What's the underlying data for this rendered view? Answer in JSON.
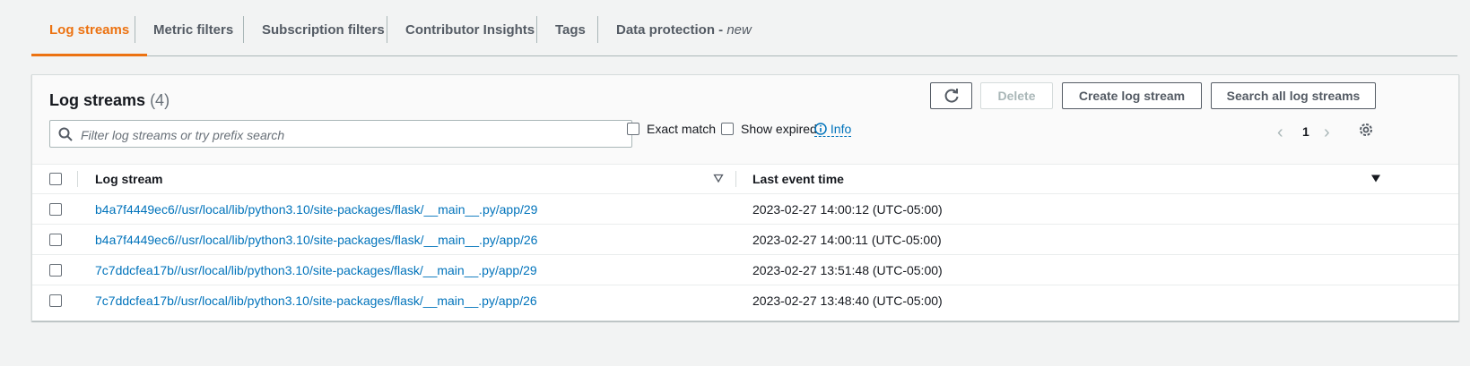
{
  "tabs": [
    {
      "label": "Log streams",
      "active": true
    },
    {
      "label": "Metric filters",
      "active": false
    },
    {
      "label": "Subscription filters",
      "active": false
    },
    {
      "label": "Contributor Insights",
      "active": false
    },
    {
      "label": "Tags",
      "active": false
    },
    {
      "label": "Data protection - ",
      "suffix": "new",
      "active": false
    }
  ],
  "panel": {
    "title": "Log streams",
    "count": "(4)",
    "buttons": {
      "delete": "Delete",
      "create": "Create log stream",
      "search_all": "Search all log streams"
    },
    "search_placeholder": "Filter log streams or try prefix search",
    "exact_match": "Exact match",
    "show_expired": "Show expired",
    "info": "Info",
    "page": "1"
  },
  "table": {
    "headers": {
      "stream": "Log stream",
      "time": "Last event time"
    },
    "rows": [
      {
        "stream": "b4a7f4449ec6//usr/local/lib/python3.10/site-packages/flask/__main__.py/app/29",
        "time": "2023-02-27 14:00:12 (UTC-05:00)"
      },
      {
        "stream": "b4a7f4449ec6//usr/local/lib/python3.10/site-packages/flask/__main__.py/app/26",
        "time": "2023-02-27 14:00:11 (UTC-05:00)"
      },
      {
        "stream": "7c7ddcfea17b//usr/local/lib/python3.10/site-packages/flask/__main__.py/app/29",
        "time": "2023-02-27 13:51:48 (UTC-05:00)"
      },
      {
        "stream": "7c7ddcfea17b//usr/local/lib/python3.10/site-packages/flask/__main__.py/app/26",
        "time": "2023-02-27 13:48:40 (UTC-05:00)"
      }
    ]
  },
  "colors": {
    "accent": "#ec7211",
    "link": "#0073bb"
  },
  "icons": [
    "refresh-icon",
    "search-icon",
    "info-icon",
    "chevron-left-icon",
    "chevron-right-icon",
    "gear-icon",
    "sort-icon"
  ]
}
